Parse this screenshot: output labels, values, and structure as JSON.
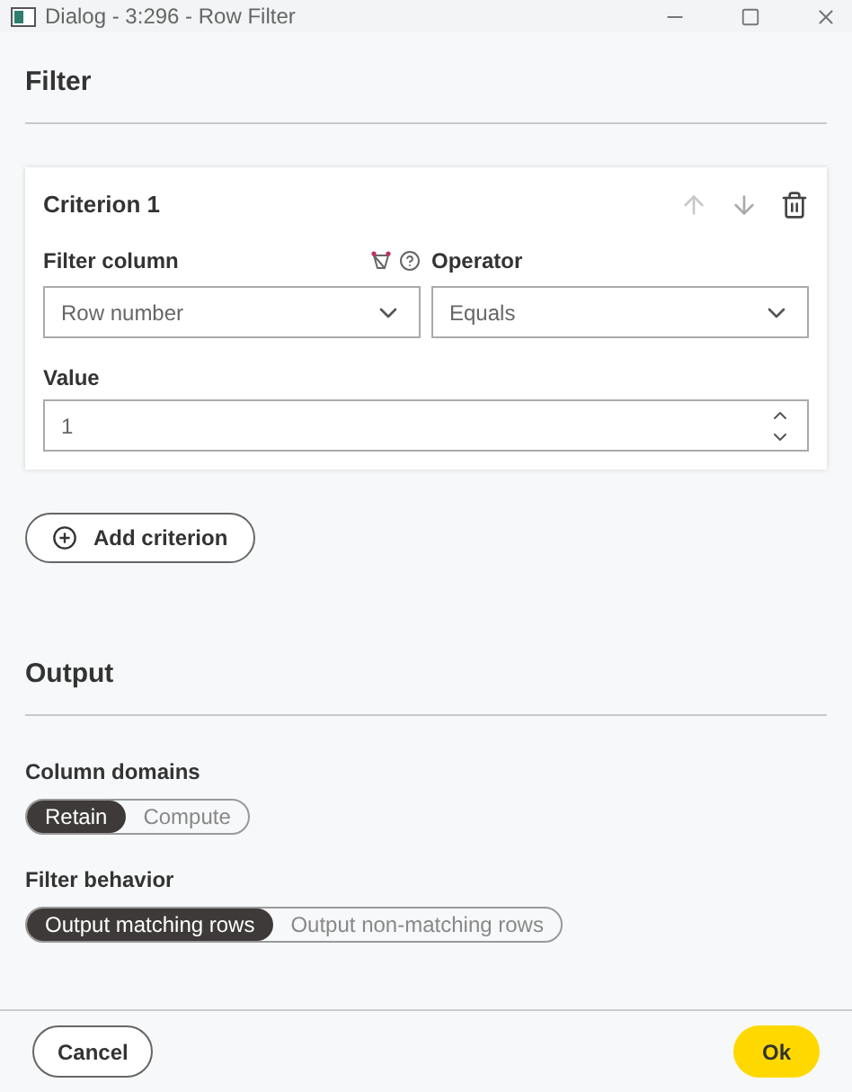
{
  "window": {
    "title": "Dialog - 3:296 - Row Filter"
  },
  "filter_section": {
    "heading": "Filter",
    "criteria": [
      {
        "title": "Criterion 1",
        "column_label": "Filter column",
        "column_value": "Row number",
        "operator_label": "Operator",
        "operator_value": "Equals",
        "value_label": "Value",
        "value": "1"
      }
    ],
    "add_button": "Add criterion"
  },
  "output_section": {
    "heading": "Output",
    "groups": [
      {
        "label": "Column domains",
        "options": [
          {
            "label": "Retain",
            "selected": true
          },
          {
            "label": "Compute",
            "selected": false
          }
        ]
      },
      {
        "label": "Filter behavior",
        "options": [
          {
            "label": "Output matching rows",
            "selected": true
          },
          {
            "label": "Output non-matching rows",
            "selected": false
          }
        ]
      }
    ]
  },
  "footer": {
    "cancel": "Cancel",
    "ok": "Ok"
  }
}
